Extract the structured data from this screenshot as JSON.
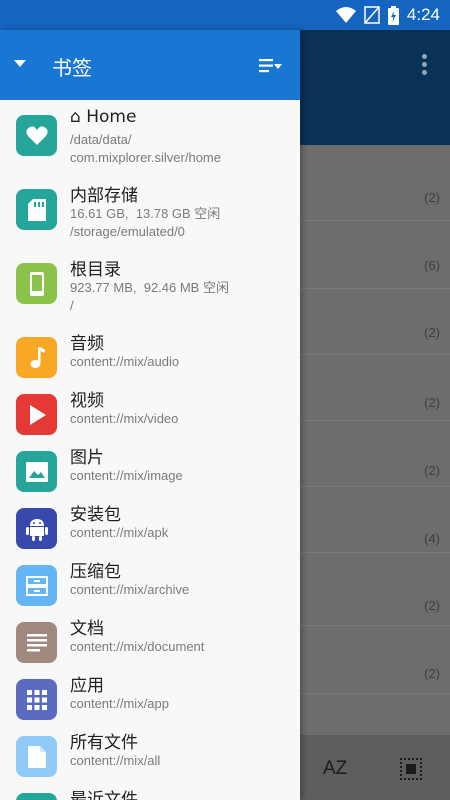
{
  "status_bar": {
    "time": "4:24",
    "icons": [
      "wifi-icon",
      "no-signal-icon",
      "battery-charging-icon"
    ]
  },
  "drawer": {
    "title": "书签",
    "header_icons": [
      "expand-arrow-icon",
      "sort-filter-icon"
    ],
    "items": [
      {
        "name": "⌂ Home",
        "path": "/data/data/\ncom.mixplorer.silver/home",
        "icon": "heart-icon",
        "color": "#26a69a"
      },
      {
        "name": "内部存储",
        "path": "16.61 GB,  13.78 GB 空闲\n/storage/emulated/0",
        "icon": "sd-card-icon",
        "color": "#26a69a"
      },
      {
        "name": "根目录",
        "path": "923.77 MB,  92.46 MB 空闲\n/",
        "icon": "phone-icon",
        "color": "#8bc34a"
      },
      {
        "name": "音频",
        "path": "content://mix/audio",
        "icon": "music-note-icon",
        "color": "#f9a825"
      },
      {
        "name": "视频",
        "path": "content://mix/video",
        "icon": "play-icon",
        "color": "#e53935"
      },
      {
        "name": "图片",
        "path": "content://mix/image",
        "icon": "image-icon",
        "color": "#26a69a"
      },
      {
        "name": "安装包",
        "path": "content://mix/apk",
        "icon": "android-icon",
        "color": "#3949ab"
      },
      {
        "name": "压缩包",
        "path": "content://mix/archive",
        "icon": "archive-icon",
        "color": "#64b5f6"
      },
      {
        "name": "文档",
        "path": "content://mix/document",
        "icon": "document-icon",
        "color": "#a1887f"
      },
      {
        "name": "应用",
        "path": "content://mix/app",
        "icon": "apps-grid-icon",
        "color": "#5c6bc0"
      },
      {
        "name": "所有文件",
        "path": "content://mix/all",
        "icon": "file-icon",
        "color": "#90caf9"
      },
      {
        "name": "最近文件",
        "path": "",
        "icon": "recent-icon",
        "color": "#26a69a"
      }
    ]
  },
  "background": {
    "counts": [
      "(2)",
      "(6)",
      "(2)",
      "(2)",
      "(2)",
      "(4)",
      "(2)",
      "(2)"
    ],
    "bottom_bar": {
      "sort_label": "AZ",
      "select_icon": "select-all-icon"
    },
    "toolbar_icons": [
      "more-vert-icon"
    ]
  }
}
